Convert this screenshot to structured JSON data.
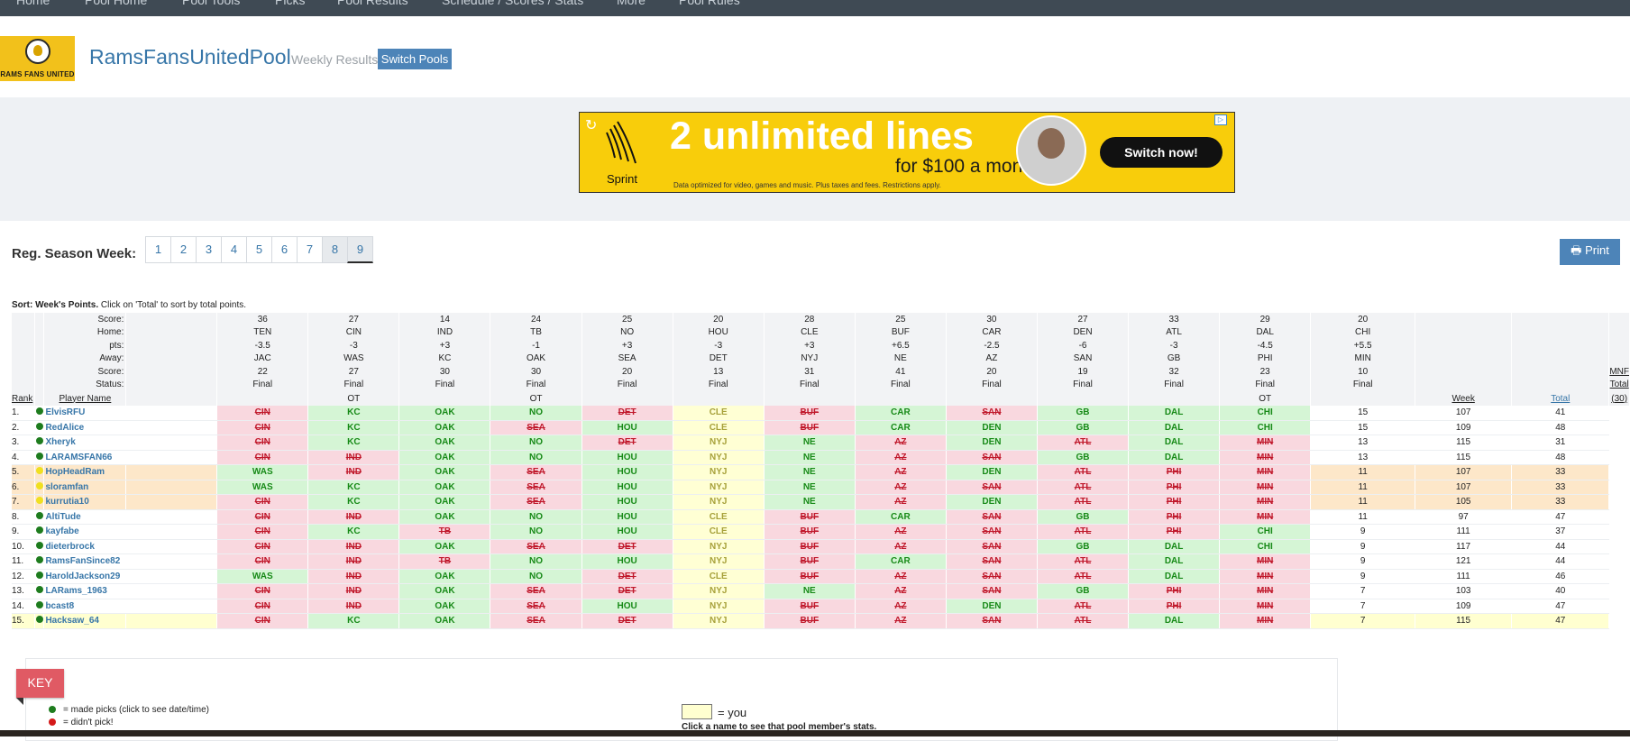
{
  "topnav": [
    "Home",
    "Pool Home",
    "Pool Tools",
    "Picks",
    "Pool Results",
    "Schedule / Scores / Stats",
    "More",
    "Pool Rules"
  ],
  "header": {
    "logo_text": "RAMS FANS UNITED",
    "pool_name": "RamsFansUnitedPool",
    "subtitle": "Weekly Results",
    "switch_label": "Switch Pools"
  },
  "ad": {
    "brand": "Sprint",
    "headline": "2 unlimited lines",
    "subline": "for $100 a month",
    "fine": "Data optimized for video, games and music. Plus taxes and fees. Restrictions apply.",
    "cta": "Switch now!"
  },
  "weeks": {
    "label": "Reg. Season Week:",
    "items": [
      "1",
      "2",
      "3",
      "4",
      "5",
      "6",
      "7",
      "8",
      "9"
    ],
    "visited": "8",
    "active": "9"
  },
  "print_label": "Print",
  "sort_note": {
    "bold": "Sort: Week's Points.",
    "rest": " Click on 'Total' to sort by total points."
  },
  "header_labels": {
    "score": "Score:",
    "home": "Home:",
    "pts": "pts:",
    "away": "Away:",
    "score2": "Score:",
    "status": "Status:",
    "rank": "Rank",
    "player": "Player Name",
    "week": "Week",
    "total": "Total",
    "mnf1": "MNF",
    "mnf2": "Total",
    "mnf3": "(30)"
  },
  "games": [
    {
      "hs": "36",
      "home": "TEN",
      "pts": "-3.5",
      "away": "JAC",
      "as": "22",
      "status": "Final",
      "ot": ""
    },
    {
      "hs": "27",
      "home": "CIN",
      "pts": "-3",
      "away": "WAS",
      "as": "27",
      "status": "Final",
      "ot": "OT"
    },
    {
      "hs": "14",
      "home": "IND",
      "pts": "+3",
      "away": "KC",
      "as": "30",
      "status": "Final",
      "ot": ""
    },
    {
      "hs": "24",
      "home": "TB",
      "pts": "-1",
      "away": "OAK",
      "as": "30",
      "status": "Final",
      "ot": "OT"
    },
    {
      "hs": "25",
      "home": "NO",
      "pts": "+3",
      "away": "SEA",
      "as": "20",
      "status": "Final",
      "ot": ""
    },
    {
      "hs": "20",
      "home": "HOU",
      "pts": "-3",
      "away": "DET",
      "as": "13",
      "status": "Final",
      "ot": ""
    },
    {
      "hs": "28",
      "home": "CLE",
      "pts": "+3",
      "away": "NYJ",
      "as": "31",
      "status": "Final",
      "ot": ""
    },
    {
      "hs": "25",
      "home": "BUF",
      "pts": "+6.5",
      "away": "NE",
      "as": "41",
      "status": "Final",
      "ot": ""
    },
    {
      "hs": "30",
      "home": "CAR",
      "pts": "-2.5",
      "away": "AZ",
      "as": "20",
      "status": "Final",
      "ot": ""
    },
    {
      "hs": "27",
      "home": "DEN",
      "pts": "-6",
      "away": "SAN",
      "as": "19",
      "status": "Final",
      "ot": ""
    },
    {
      "hs": "33",
      "home": "ATL",
      "pts": "-3",
      "away": "GB",
      "as": "32",
      "status": "Final",
      "ot": ""
    },
    {
      "hs": "29",
      "home": "DAL",
      "pts": "-4.5",
      "away": "PHI",
      "as": "23",
      "status": "Final",
      "ot": "OT"
    },
    {
      "hs": "20",
      "home": "CHI",
      "pts": "+5.5",
      "away": "MIN",
      "as": "10",
      "status": "Final",
      "ot": ""
    }
  ],
  "players": [
    {
      "rank": "1.",
      "name": "ElvisRFU",
      "dot": "green",
      "hl": "",
      "picks": [
        [
          "",
          ""
        ],
        [
          "CIN",
          "r"
        ],
        [
          "KC",
          "g"
        ],
        [
          "OAK",
          "g"
        ],
        [
          "NO",
          "g"
        ],
        [
          "DET",
          "r"
        ],
        [
          "CLE",
          "y"
        ],
        [
          "BUF",
          "r"
        ],
        [
          "CAR",
          "g"
        ],
        [
          "SAN",
          "r"
        ],
        [
          "GB",
          "g"
        ],
        [
          "DAL",
          "g"
        ],
        [
          "CHI",
          "g"
        ]
      ],
      "week": "15",
      "total": "107",
      "mnf": "41"
    },
    {
      "rank": "2.",
      "name": "RedAlice",
      "dot": "green",
      "hl": "",
      "picks": [
        [
          "",
          ""
        ],
        [
          "CIN",
          "r"
        ],
        [
          "KC",
          "g"
        ],
        [
          "OAK",
          "g"
        ],
        [
          "SEA",
          "r"
        ],
        [
          "HOU",
          "g"
        ],
        [
          "CLE",
          "y"
        ],
        [
          "BUF",
          "r"
        ],
        [
          "CAR",
          "g"
        ],
        [
          "DEN",
          "g"
        ],
        [
          "GB",
          "g"
        ],
        [
          "DAL",
          "g"
        ],
        [
          "CHI",
          "g"
        ]
      ],
      "week": "15",
      "total": "109",
      "mnf": "48"
    },
    {
      "rank": "3.",
      "name": "Xheryk",
      "dot": "green",
      "hl": "",
      "picks": [
        [
          "",
          ""
        ],
        [
          "CIN",
          "r"
        ],
        [
          "KC",
          "g"
        ],
        [
          "OAK",
          "g"
        ],
        [
          "NO",
          "g"
        ],
        [
          "DET",
          "r"
        ],
        [
          "NYJ",
          "y"
        ],
        [
          "NE",
          "g"
        ],
        [
          "AZ",
          "r"
        ],
        [
          "DEN",
          "g"
        ],
        [
          "ATL",
          "r"
        ],
        [
          "DAL",
          "g"
        ],
        [
          "MIN",
          "r"
        ]
      ],
      "week": "13",
      "total": "115",
      "mnf": "31"
    },
    {
      "rank": "4.",
      "name": "LARAMSFAN66",
      "dot": "green",
      "hl": "",
      "picks": [
        [
          "",
          ""
        ],
        [
          "CIN",
          "r"
        ],
        [
          "IND",
          "r"
        ],
        [
          "OAK",
          "g"
        ],
        [
          "NO",
          "g"
        ],
        [
          "HOU",
          "g"
        ],
        [
          "NYJ",
          "y"
        ],
        [
          "NE",
          "g"
        ],
        [
          "AZ",
          "r"
        ],
        [
          "SAN",
          "r"
        ],
        [
          "GB",
          "g"
        ],
        [
          "DAL",
          "g"
        ],
        [
          "MIN",
          "r"
        ]
      ],
      "week": "13",
      "total": "115",
      "mnf": "48"
    },
    {
      "rank": "5.",
      "name": "HopHeadRam",
      "dot": "yellow",
      "hl": "hl",
      "picks": [
        [
          "",
          ""
        ],
        [
          "WAS",
          "g"
        ],
        [
          "IND",
          "r"
        ],
        [
          "OAK",
          "g"
        ],
        [
          "SEA",
          "r"
        ],
        [
          "HOU",
          "g"
        ],
        [
          "NYJ",
          "y"
        ],
        [
          "NE",
          "g"
        ],
        [
          "AZ",
          "r"
        ],
        [
          "DEN",
          "g"
        ],
        [
          "ATL",
          "r"
        ],
        [
          "PHI",
          "r"
        ],
        [
          "MIN",
          "r"
        ]
      ],
      "week": "11",
      "total": "107",
      "mnf": "33"
    },
    {
      "rank": "6.",
      "name": "sloramfan",
      "dot": "yellow",
      "hl": "hl",
      "picks": [
        [
          "",
          ""
        ],
        [
          "WAS",
          "g"
        ],
        [
          "KC",
          "g"
        ],
        [
          "OAK",
          "g"
        ],
        [
          "SEA",
          "r"
        ],
        [
          "HOU",
          "g"
        ],
        [
          "NYJ",
          "y"
        ],
        [
          "NE",
          "g"
        ],
        [
          "AZ",
          "r"
        ],
        [
          "SAN",
          "r"
        ],
        [
          "ATL",
          "r"
        ],
        [
          "PHI",
          "r"
        ],
        [
          "MIN",
          "r"
        ]
      ],
      "week": "11",
      "total": "107",
      "mnf": "33"
    },
    {
      "rank": "7.",
      "name": "kurrutia10",
      "dot": "yellow",
      "hl": "hl",
      "picks": [
        [
          "",
          ""
        ],
        [
          "CIN",
          "r"
        ],
        [
          "KC",
          "g"
        ],
        [
          "OAK",
          "g"
        ],
        [
          "SEA",
          "r"
        ],
        [
          "HOU",
          "g"
        ],
        [
          "NYJ",
          "y"
        ],
        [
          "NE",
          "g"
        ],
        [
          "AZ",
          "r"
        ],
        [
          "DEN",
          "g"
        ],
        [
          "ATL",
          "r"
        ],
        [
          "PHI",
          "r"
        ],
        [
          "MIN",
          "r"
        ]
      ],
      "week": "11",
      "total": "105",
      "mnf": "33"
    },
    {
      "rank": "8.",
      "name": "AltiTude",
      "dot": "green",
      "hl": "",
      "picks": [
        [
          "",
          ""
        ],
        [
          "CIN",
          "r"
        ],
        [
          "IND",
          "r"
        ],
        [
          "OAK",
          "g"
        ],
        [
          "NO",
          "g"
        ],
        [
          "HOU",
          "g"
        ],
        [
          "CLE",
          "y"
        ],
        [
          "BUF",
          "r"
        ],
        [
          "CAR",
          "g"
        ],
        [
          "SAN",
          "r"
        ],
        [
          "GB",
          "g"
        ],
        [
          "PHI",
          "r"
        ],
        [
          "MIN",
          "r"
        ]
      ],
      "week": "11",
      "total": "97",
      "mnf": "47"
    },
    {
      "rank": "9.",
      "name": "kayfabe",
      "dot": "green",
      "hl": "",
      "picks": [
        [
          "",
          ""
        ],
        [
          "CIN",
          "r"
        ],
        [
          "KC",
          "g"
        ],
        [
          "TB",
          "r"
        ],
        [
          "NO",
          "g"
        ],
        [
          "HOU",
          "g"
        ],
        [
          "CLE",
          "y"
        ],
        [
          "BUF",
          "r"
        ],
        [
          "AZ",
          "r"
        ],
        [
          "SAN",
          "r"
        ],
        [
          "ATL",
          "r"
        ],
        [
          "PHI",
          "r"
        ],
        [
          "CHI",
          "g"
        ]
      ],
      "week": "9",
      "total": "111",
      "mnf": "37"
    },
    {
      "rank": "10.",
      "name": "dieterbrock",
      "dot": "green",
      "hl": "",
      "picks": [
        [
          "",
          ""
        ],
        [
          "CIN",
          "r"
        ],
        [
          "IND",
          "r"
        ],
        [
          "OAK",
          "g"
        ],
        [
          "SEA",
          "r"
        ],
        [
          "DET",
          "r"
        ],
        [
          "NYJ",
          "y"
        ],
        [
          "BUF",
          "r"
        ],
        [
          "AZ",
          "r"
        ],
        [
          "SAN",
          "r"
        ],
        [
          "GB",
          "g"
        ],
        [
          "DAL",
          "g"
        ],
        [
          "CHI",
          "g"
        ]
      ],
      "week": "9",
      "total": "117",
      "mnf": "44"
    },
    {
      "rank": "11.",
      "name": "RamsFanSince82",
      "dot": "green",
      "hl": "",
      "picks": [
        [
          "",
          ""
        ],
        [
          "CIN",
          "r"
        ],
        [
          "IND",
          "r"
        ],
        [
          "TB",
          "r"
        ],
        [
          "NO",
          "g"
        ],
        [
          "HOU",
          "g"
        ],
        [
          "NYJ",
          "y"
        ],
        [
          "BUF",
          "r"
        ],
        [
          "CAR",
          "g"
        ],
        [
          "SAN",
          "r"
        ],
        [
          "ATL",
          "r"
        ],
        [
          "DAL",
          "g"
        ],
        [
          "MIN",
          "r"
        ]
      ],
      "week": "9",
      "total": "121",
      "mnf": "44"
    },
    {
      "rank": "12.",
      "name": "HaroldJackson29",
      "dot": "green",
      "hl": "",
      "picks": [
        [
          "",
          ""
        ],
        [
          "WAS",
          "g"
        ],
        [
          "IND",
          "r"
        ],
        [
          "OAK",
          "g"
        ],
        [
          "NO",
          "g"
        ],
        [
          "DET",
          "r"
        ],
        [
          "CLE",
          "y"
        ],
        [
          "BUF",
          "r"
        ],
        [
          "AZ",
          "r"
        ],
        [
          "SAN",
          "r"
        ],
        [
          "ATL",
          "r"
        ],
        [
          "DAL",
          "g"
        ],
        [
          "MIN",
          "r"
        ]
      ],
      "week": "9",
      "total": "111",
      "mnf": "46"
    },
    {
      "rank": "13.",
      "name": "LARams_1963",
      "dot": "green",
      "hl": "",
      "picks": [
        [
          "",
          ""
        ],
        [
          "CIN",
          "r"
        ],
        [
          "IND",
          "r"
        ],
        [
          "OAK",
          "g"
        ],
        [
          "SEA",
          "r"
        ],
        [
          "DET",
          "r"
        ],
        [
          "NYJ",
          "y"
        ],
        [
          "NE",
          "g"
        ],
        [
          "AZ",
          "r"
        ],
        [
          "SAN",
          "r"
        ],
        [
          "GB",
          "g"
        ],
        [
          "PHI",
          "r"
        ],
        [
          "MIN",
          "r"
        ]
      ],
      "week": "7",
      "total": "103",
      "mnf": "40"
    },
    {
      "rank": "14.",
      "name": "bcast8",
      "dot": "green",
      "hl": "",
      "picks": [
        [
          "",
          ""
        ],
        [
          "CIN",
          "r"
        ],
        [
          "IND",
          "r"
        ],
        [
          "OAK",
          "g"
        ],
        [
          "SEA",
          "r"
        ],
        [
          "HOU",
          "g"
        ],
        [
          "NYJ",
          "y"
        ],
        [
          "BUF",
          "r"
        ],
        [
          "AZ",
          "r"
        ],
        [
          "DEN",
          "g"
        ],
        [
          "ATL",
          "r"
        ],
        [
          "PHI",
          "r"
        ],
        [
          "MIN",
          "r"
        ]
      ],
      "week": "7",
      "total": "109",
      "mnf": "47"
    },
    {
      "rank": "15.",
      "name": "Hacksaw_64",
      "dot": "green",
      "hl": "me",
      "picks": [
        [
          "",
          ""
        ],
        [
          "CIN",
          "r"
        ],
        [
          "KC",
          "g"
        ],
        [
          "OAK",
          "g"
        ],
        [
          "SEA",
          "r"
        ],
        [
          "DET",
          "r"
        ],
        [
          "NYJ",
          "y"
        ],
        [
          "BUF",
          "r"
        ],
        [
          "AZ",
          "r"
        ],
        [
          "SAN",
          "r"
        ],
        [
          "ATL",
          "r"
        ],
        [
          "DAL",
          "g"
        ],
        [
          "MIN",
          "r"
        ]
      ],
      "week": "7",
      "total": "115",
      "mnf": "47"
    }
  ],
  "key": {
    "title": "KEY",
    "made": "= made picks (click to see date/time)",
    "didnt": "= didn't pick!",
    "you": "=  you",
    "click_note": "Click a name to see that pool member's stats."
  }
}
